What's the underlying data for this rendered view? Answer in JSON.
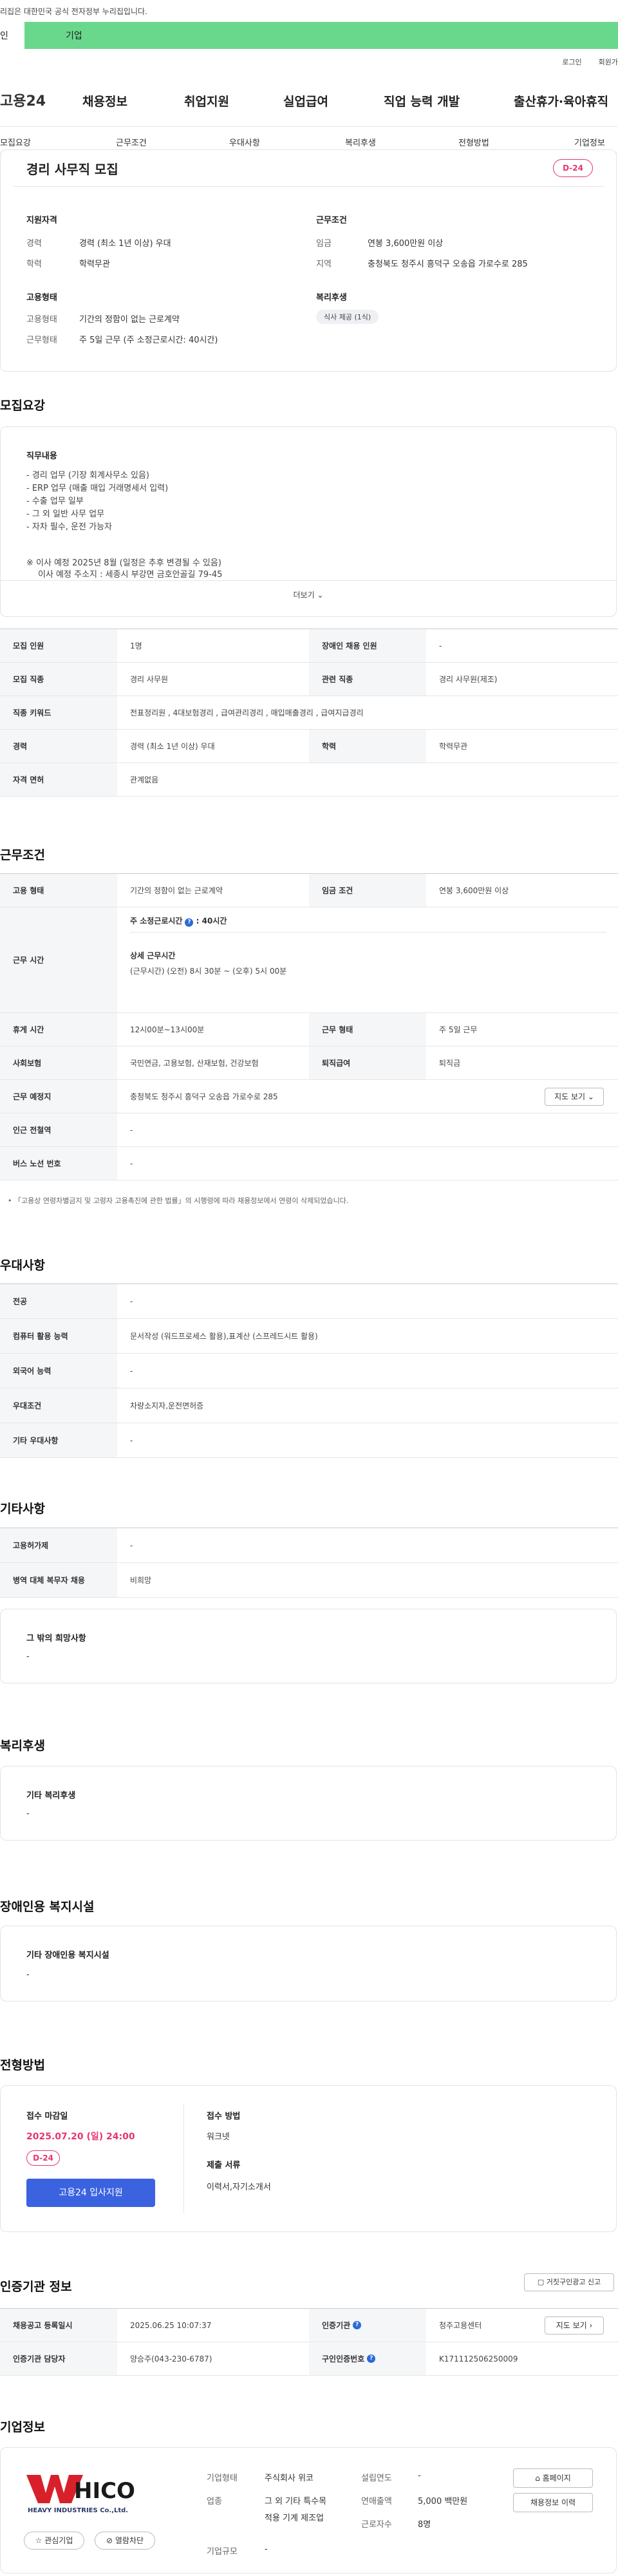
{
  "gov_banner": "리집은 대한민국 공식 전자정부 누리집입니다.",
  "tabs": {
    "personal": "인",
    "company": "기업"
  },
  "util": {
    "login": "로그인",
    "join": "회원가"
  },
  "gnb": {
    "logo": "고용24",
    "items": [
      "채용정보",
      "취업지원",
      "실업급여",
      "직업 능력 개발",
      "출산휴가·육아휴직"
    ]
  },
  "subnav": [
    "모집요강",
    "근무조건",
    "우대사항",
    "복리후생",
    "전형방법",
    "기업정보"
  ],
  "summary": {
    "title": "경리 사무직 모집",
    "dday": "D-24",
    "qual_title": "지원자격",
    "career_label": "경력",
    "career": "경력 (최소 1년 이상) 우대",
    "edu_label": "학력",
    "edu": "학력무관",
    "cond_title": "근무조건",
    "wage_label": "임금",
    "wage": "연봉 3,600만원 이상",
    "region_label": "지역",
    "region": "충청북도 청주시 흥덕구 오송읍 가로수로 285",
    "emp_title": "고용형태",
    "emptype_label": "고용형태",
    "emptype": "기간의 정함이 없는 근로계약",
    "worktype_label": "근무형태",
    "worktype": "주 5일 근무 (주 소정근로시간: 40시간)",
    "welfare_title": "복리후생",
    "welfare_tag": "식사 제공 (1식)"
  },
  "recruit": {
    "heading": "모집요강",
    "duty_title": "직무내용",
    "duties": [
      "- 경리 업무 (기장 회계사무소 있음)",
      "- ERP 업무 (매출 매입 거래명세서 입력)",
      "- 수출 업무 일부",
      "- 그 외 일반 사무 업무",
      "- 자차 필수, 운전 가능자"
    ],
    "notice1": "※ 이사 예정 2025년 8월 (일정은 추후 변경될 수 있음)",
    "notice2": "이사 예정 주소지 : 세종시 부강면 금호안골길 79-45",
    "more": "더보기",
    "rows": [
      {
        "h1": "모집 인원",
        "v1": "1명",
        "h2": "장애인 채용 인원",
        "v2": "-"
      },
      {
        "h1": "모집 직종",
        "v1": "경리 사무원",
        "h2": "관련 직종",
        "v2": "경리 사무원(제조)"
      },
      {
        "h1": "직종 키워드",
        "v1": "전표정리원 , 4대보험경리 , 급여관리경리 , 매입매출경리 , 급여지급경리"
      },
      {
        "h1": "경력",
        "v1": "경력 (최소 1년 이상) 우대",
        "h2": "학력",
        "v2": "학력무관"
      },
      {
        "h1": "자격 면허",
        "v1": "관계없음"
      }
    ]
  },
  "work": {
    "heading": "근무조건",
    "emptype_h": "고용 형태",
    "emptype": "기간의 정함이 없는 근로계약",
    "wage_h": "임금 조건",
    "wage": "연봉 3,600만원 이상",
    "hours_h": "근무 시간",
    "hours_main": "주 소정근로시간",
    "hours_val": "40시간",
    "hours_detail_title": "상세 근무시간",
    "hours_detail": "(근무시간) (오전) 8시 30분 ~ (오후) 5시 00분",
    "break_h": "휴게 시간",
    "break": "12시00분~13시00분",
    "form_h": "근무 형태",
    "form": "주 5일 근무",
    "ins_h": "사회보험",
    "ins": "국민연금, 고용보험, 산재보험, 건강보험",
    "retire_h": "퇴직급여",
    "retire": "퇴직금",
    "place_h": "근무 예정지",
    "place": "충청북도 청주시 흥덕구 오송읍 가로수로 285",
    "map_btn": "지도 보기",
    "subway_h": "인근 전철역",
    "subway": "-",
    "bus_h": "버스 노선 번호",
    "bus": "-",
    "note": "「고용상 연령차별금지 및 고령자 고용촉진에 관한 법률」의 시행령에 따라 채용정보에서 연령이 삭제되었습니다."
  },
  "pref": {
    "heading": "우대사항",
    "rows": [
      {
        "h": "전공",
        "v": "-"
      },
      {
        "h": "컴퓨터 활용 능력",
        "v": "문서작성 (워드프로세스 활용),표계산 (스프레드시트 활용)"
      },
      {
        "h": "외국어 능력",
        "v": "-"
      },
      {
        "h": "우대조건",
        "v": "차량소지자,운전면허증"
      },
      {
        "h": "기타 우대사항",
        "v": "-"
      }
    ]
  },
  "etc": {
    "heading": "기타사항",
    "rows": [
      {
        "h": "고용허가제",
        "v": "-"
      },
      {
        "h": "병역 대체 복무자 채용",
        "v": "비희망"
      }
    ],
    "other_title": "그 밖의 희망사항",
    "other": "-"
  },
  "welfare": {
    "heading": "복리후생",
    "box_title": "기타 복리후생",
    "box_val": "-"
  },
  "disabled": {
    "heading": "장애인용 복지시설",
    "box_title": "기타 장애인용 복지시설",
    "box_val": "-"
  },
  "selection": {
    "heading": "전형방법",
    "deadline_title": "접수 마감일",
    "deadline": "2025.07.20 (일) 24:00",
    "dday": "D-24",
    "apply_btn": "고용24 입사지원",
    "method_title": "접수 방법",
    "method": "워크넷",
    "docs_title": "제출 서류",
    "docs": "이력서,자기소개서"
  },
  "cert": {
    "heading": "인증기관 정보",
    "report_btn": "거짓구인광고 신고",
    "reg_h": "채용공고 등록일시",
    "reg": "2025.06.25 10:07:37",
    "org_h": "인증기관",
    "org": "청주고용센터",
    "map_btn": "지도 보기",
    "mgr_h": "인증기관 담당자",
    "mgr": "양승주(043-230-6787)",
    "no_h": "구인인증번호",
    "no": "K171112506250009"
  },
  "company": {
    "heading": "기업정보",
    "logo_text": "HICO",
    "logo_sub": "HEAVY INDUSTRIES Co.,Ltd.",
    "fav_btn": "관심기업",
    "block_btn": "열람차단",
    "type_l": "기업형태",
    "type": "주식회사 위코",
    "year_l": "설립연도",
    "year": "-",
    "biz_l": "업종",
    "biz1": "그 외 기타 특수목",
    "biz2": "적용 기계 제조업",
    "sales_l": "연매출액",
    "sales": "5,000 백만원",
    "emp_l": "근로자수",
    "emp": "8명",
    "size_l": "기업규모",
    "size": "-",
    "home_btn": "홈페이지",
    "jobs_btn": "채용정보 이력"
  }
}
